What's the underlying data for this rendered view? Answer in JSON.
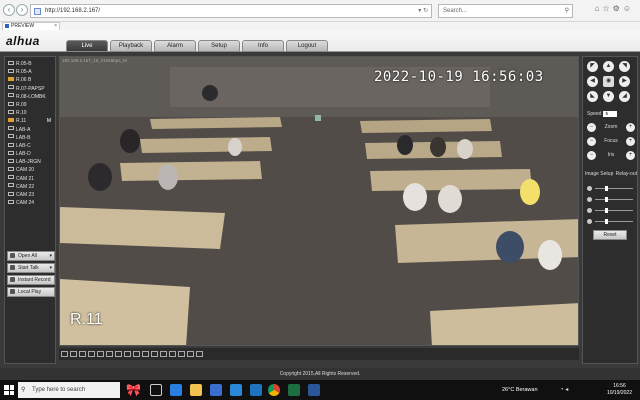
{
  "browser": {
    "url": "http://192.168.2.167/",
    "search_placeholder": "Search...",
    "tab_title": "PREVIEW"
  },
  "app": {
    "logo": "alhua",
    "tabs": [
      "Live",
      "Playback",
      "Alarm",
      "Setup",
      "Info",
      "Logout"
    ]
  },
  "channels": [
    {
      "label": "R.05-B",
      "rec": false,
      "mark": ""
    },
    {
      "label": "R.05-A",
      "rec": false,
      "mark": ""
    },
    {
      "label": "R.06 B",
      "rec": true,
      "mark": ""
    },
    {
      "label": "R.07-PAPSP",
      "rec": false,
      "mark": ""
    },
    {
      "label": "R.08-LOMBK",
      "rec": false,
      "mark": ""
    },
    {
      "label": "R.09",
      "rec": false,
      "mark": ""
    },
    {
      "label": "R.10",
      "rec": false,
      "mark": ""
    },
    {
      "label": "R.11",
      "rec": true,
      "mark": "M"
    },
    {
      "label": "LAB-A",
      "rec": false,
      "mark": ""
    },
    {
      "label": "LAB-B",
      "rec": false,
      "mark": ""
    },
    {
      "label": "LAB-C",
      "rec": false,
      "mark": ""
    },
    {
      "label": "LAB-D",
      "rec": false,
      "mark": ""
    },
    {
      "label": "LAB-JRGN",
      "rec": false,
      "mark": ""
    },
    {
      "label": "CAM 20",
      "rec": false,
      "mark": ""
    },
    {
      "label": "CAM 21",
      "rec": false,
      "mark": ""
    },
    {
      "label": "CAM 22",
      "rec": false,
      "mark": ""
    },
    {
      "label": "CAM 23",
      "rec": false,
      "mark": ""
    },
    {
      "label": "CAM 24",
      "rec": false,
      "mark": ""
    }
  ],
  "side_buttons": {
    "open_all": "Open All",
    "start_talk": "Start Talk",
    "instant_record": "Instant Record",
    "local_play": "Local Play"
  },
  "video": {
    "info": "192.168.2.167_16_01065bps_M",
    "timestamp": "2022-10-19 16:56:03",
    "channel_name": "R.11"
  },
  "ptz": {
    "speed_label": "Speed",
    "speed_value": "5",
    "zoom": "Zoom",
    "focus": "Focus",
    "iris": "Iris",
    "image_setup": "Image Setup",
    "relay_out": "Relay-out",
    "reset": "Reset",
    "slider_levels": [
      0.25,
      0.25,
      0.25,
      0.25
    ]
  },
  "footer": {
    "copyright": "Copyright 2015,All Rights Reserved."
  },
  "taskbar": {
    "search_placeholder": "Type here to search",
    "weather": "26°C  Berawan",
    "time": "16:56",
    "date": "10/19/2022"
  }
}
